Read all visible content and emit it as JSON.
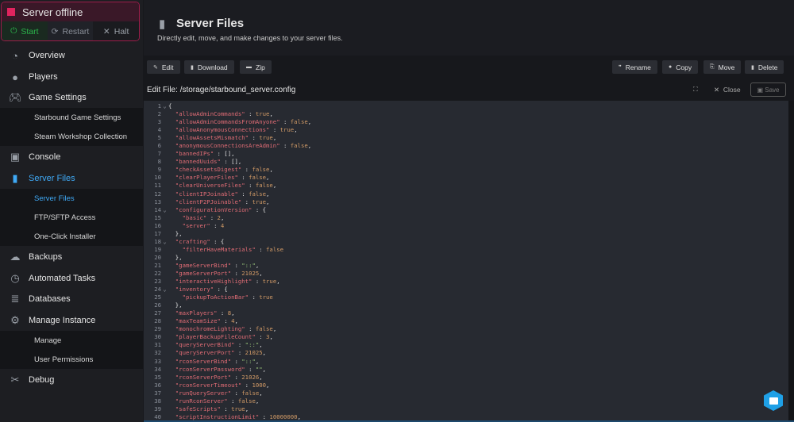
{
  "status": {
    "label": "Server offline",
    "start": "Start",
    "restart": "Restart",
    "halt": "Halt",
    "color": "#e0245e"
  },
  "sidebar": {
    "overview": "Overview",
    "players": "Players",
    "game_settings": "Game Settings",
    "starbound_settings": "Starbound Game Settings",
    "workshop": "Steam Workshop Collection",
    "console": "Console",
    "server_files": "Server Files",
    "server_files_sub": "Server Files",
    "ftp": "FTP/SFTP Access",
    "installer": "One-Click Installer",
    "backups": "Backups",
    "tasks": "Automated Tasks",
    "databases": "Databases",
    "manage_instance": "Manage Instance",
    "manage": "Manage",
    "permissions": "User Permissions",
    "debug": "Debug"
  },
  "header": {
    "title": "Server Files",
    "description": "Directly edit, move, and make changes to your server files."
  },
  "toolbar": {
    "edit": "Edit",
    "download": "Download",
    "zip": "Zip",
    "rename": "Rename",
    "copy": "Copy",
    "move": "Move",
    "delete": "Delete"
  },
  "editbar": {
    "label": "Edit File:",
    "path": "/storage/starbound_server.config",
    "close": "Close",
    "save": "Save"
  },
  "code": [
    "{",
    "  \"allowAdminCommands\" : true,",
    "  \"allowAdminCommandsFromAnyone\" : false,",
    "  \"allowAnonymousConnections\" : true,",
    "  \"allowAssetsMismatch\" : true,",
    "  \"anonymousConnectionsAreAdmin\" : false,",
    "  \"bannedIPs\" : [],",
    "  \"bannedUuids\" : [],",
    "  \"checkAssetsDigest\" : false,",
    "  \"clearPlayerFiles\" : false,",
    "  \"clearUniverseFiles\" : false,",
    "  \"clientIPJoinable\" : false,",
    "  \"clientP2PJoinable\" : true,",
    "  \"configurationVersion\" : {",
    "    \"basic\" : 2,",
    "    \"server\" : 4",
    "  },",
    "  \"crafting\" : {",
    "    \"filterHaveMaterials\" : false",
    "  },",
    "  \"gameServerBind\" : \"::\",",
    "  \"gameServerPort\" : 21025,",
    "  \"interactiveHighlight\" : true,",
    "  \"inventory\" : {",
    "    \"pickupToActionBar\" : true",
    "  },",
    "  \"maxPlayers\" : 8,",
    "  \"maxTeamSize\" : 4,",
    "  \"monochromeLighting\" : false,",
    "  \"playerBackupFileCount\" : 3,",
    "  \"queryServerBind\" : \"::\",",
    "  \"queryServerPort\" : 21025,",
    "  \"rconServerBind\" : \"::\",",
    "  \"rconServerPassword\" : \"\",",
    "  \"rconServerPort\" : 21026,",
    "  \"rconServerTimeout\" : 1000,",
    "  \"runQueryServer\" : false,",
    "  \"runRconServer\" : false,",
    "  \"safeScripts\" : true,",
    "  \"scriptInstructionLimit\" : 10000000,"
  ]
}
